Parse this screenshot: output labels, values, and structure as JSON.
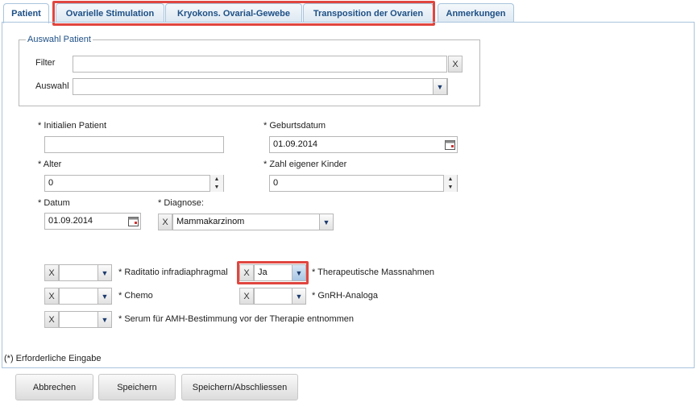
{
  "tabs": [
    {
      "label": "Patient",
      "active": true
    },
    {
      "label": "Ovarielle Stimulation",
      "active": false
    },
    {
      "label": "Kryokons. Ovarial-Gewebe",
      "active": false
    },
    {
      "label": "Transposition der Ovarien",
      "active": false
    },
    {
      "label": "Anmerkungen",
      "active": false
    }
  ],
  "patient_select": {
    "legend": "Auswahl Patient",
    "filter_label": "Filter",
    "filter_value": "",
    "filter_clear": "X",
    "auswahl_label": "Auswahl",
    "auswahl_value": ""
  },
  "form": {
    "initials_label": "* Initialien Patient",
    "initials_value": "",
    "birthdate_label": "* Geburtsdatum",
    "birthdate_value": "01.09.2014",
    "age_label": "* Alter",
    "age_value": "0",
    "children_label": "* Zahl eigener Kinder",
    "children_value": "0",
    "date_label": "* Datum",
    "date_value": "01.09.2014",
    "diagnosis_label": "* Diagnose:",
    "diagnosis_clear": "X",
    "diagnosis_value": "Mammakarzinom"
  },
  "options": {
    "clear": "X",
    "radiatio_label": "* Raditatio infradiaphragmal",
    "radiatio_value": "",
    "therapeutische_label": "* Therapeutische Massnahmen",
    "therapeutische_value": "Ja",
    "chemo_label": "* Chemo",
    "chemo_value": "",
    "gnrh_label": "* GnRH-Analoga",
    "gnrh_value": "",
    "serum_label": "* Serum für AMH-Bestimmung vor der Therapie entnommen",
    "serum_value": ""
  },
  "required_note": "(*) Erforderliche Eingabe",
  "buttons": {
    "cancel": "Abbrechen",
    "save": "Speichern",
    "save_close": "Speichern/Abschliessen"
  },
  "colors": {
    "tab_text": "#1d4f85",
    "highlight": "#e0463f"
  }
}
